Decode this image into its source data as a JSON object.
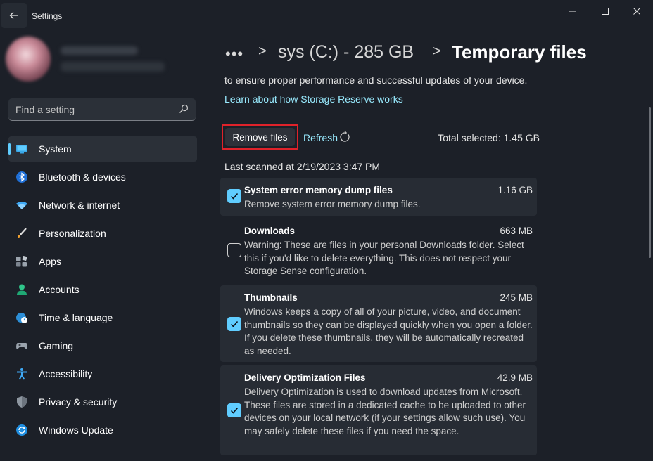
{
  "window": {
    "title": "Settings",
    "controls": [
      "minimize-icon",
      "maximize-icon",
      "close-icon"
    ]
  },
  "search": {
    "placeholder": "Find a setting"
  },
  "sidebar": {
    "items": [
      {
        "label": "System",
        "icon": "system-icon",
        "active": true
      },
      {
        "label": "Bluetooth & devices",
        "icon": "bluetooth-icon"
      },
      {
        "label": "Network & internet",
        "icon": "network-icon"
      },
      {
        "label": "Personalization",
        "icon": "brush-icon"
      },
      {
        "label": "Apps",
        "icon": "apps-icon"
      },
      {
        "label": "Accounts",
        "icon": "accounts-icon"
      },
      {
        "label": "Time & language",
        "icon": "globe-clock-icon"
      },
      {
        "label": "Gaming",
        "icon": "gamepad-icon"
      },
      {
        "label": "Accessibility",
        "icon": "accessibility-icon"
      },
      {
        "label": "Privacy & security",
        "icon": "shield-icon"
      },
      {
        "label": "Windows Update",
        "icon": "update-icon"
      }
    ]
  },
  "breadcrumb": {
    "ellipsis": "•••",
    "separator": ">",
    "items": [
      "sys (C:) - 285 GB",
      "Temporary files"
    ]
  },
  "main": {
    "intro_text": "to ensure proper performance and successful updates of your device.",
    "learn_link": "Learn about how Storage Reserve works",
    "remove_label": "Remove files",
    "refresh_label": "Refresh",
    "total_selected": "Total selected: 1.45 GB",
    "last_scanned": "Last scanned at 2/19/2023 3:47 PM"
  },
  "files": [
    {
      "title": "System error memory dump files",
      "size": "1.16 GB",
      "desc": "Remove system error memory dump files.",
      "checked": true
    },
    {
      "title": "Downloads",
      "size": "663 MB",
      "desc": "Warning: These are files in your personal Downloads folder. Select this if you'd like to delete everything. This does not respect your Storage Sense configuration.",
      "checked": false
    },
    {
      "title": "Thumbnails",
      "size": "245 MB",
      "desc": "Windows keeps a copy of all of your picture, video, and document thumbnails so they can be displayed quickly when you open a folder. If you delete these thumbnails, they will be automatically recreated as needed.",
      "checked": true
    },
    {
      "title": "Delivery Optimization Files",
      "size": "42.9 MB",
      "desc": "Delivery Optimization is used to download updates from Microsoft. These files are stored in a dedicated cache to be uploaded to other devices on your local network (if your settings allow such use). You may safely delete these files if you need the space.",
      "checked": true
    }
  ],
  "colors": {
    "background": "#1c2028",
    "accent": "#60cdff",
    "link": "#99ebff",
    "highlight_box": "#e0222a"
  }
}
